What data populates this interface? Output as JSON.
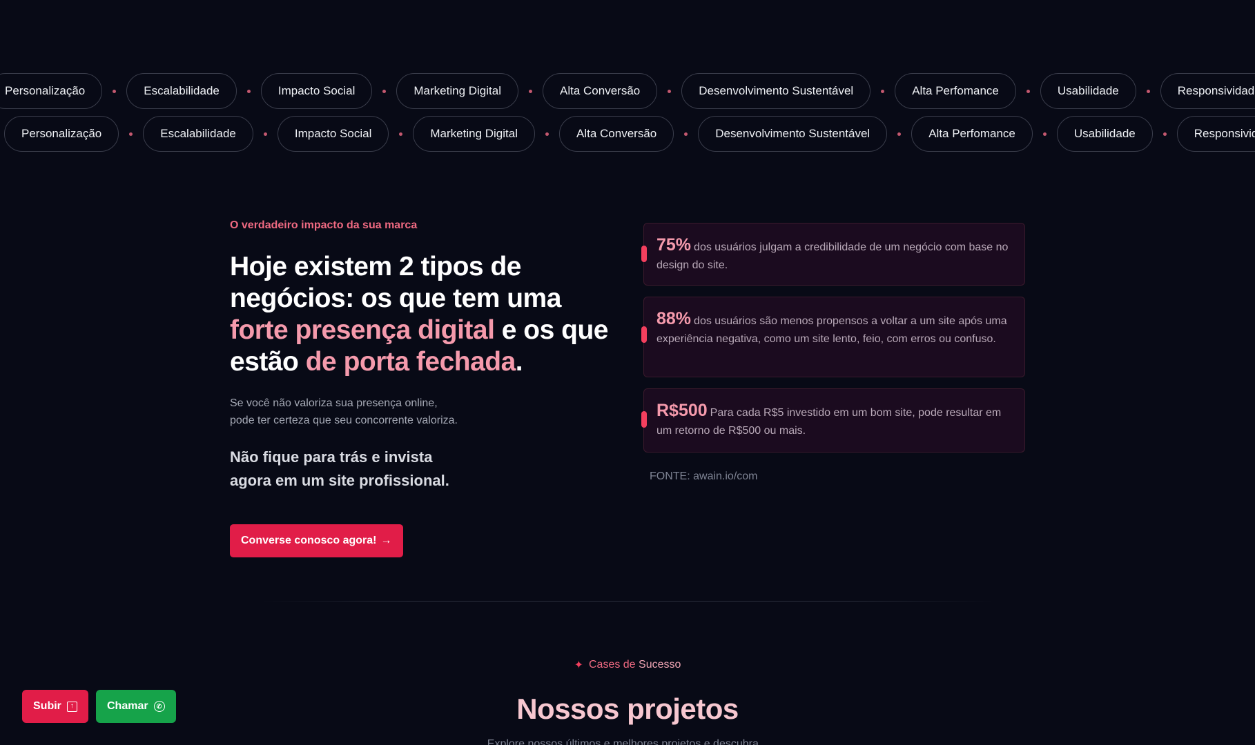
{
  "marquee": {
    "row1": [
      "Personalização",
      "Escalabilidade",
      "Impacto Social",
      "Marketing Digital",
      "Alta Conversão",
      "Desenvolvimento Sustentável",
      "Alta Perfomance",
      "Usabilidade",
      "Responsividade"
    ],
    "row2": [
      "Personalização",
      "Escalabilidade",
      "Impacto Social",
      "Marketing Digital",
      "Alta Conversão",
      "Desenvolvimento Sustentável",
      "Alta Perfomance",
      "Usabilidade",
      "Responsividade"
    ]
  },
  "hero": {
    "eyebrow": "O verdadeiro impacto da sua marca",
    "headline_part1": "Hoje existem 2 tipos de negócios: os que tem uma ",
    "headline_highlight1": "forte presença digital",
    "headline_part2": " e os que estão ",
    "headline_highlight2": "de porta fechada",
    "headline_end": ".",
    "lead_line1": "Se você não valoriza sua presença online,",
    "lead_line2": "pode ter certeza que seu concorrente valoriza.",
    "cta_line1": "Não fique para trás e invista",
    "cta_line2": "agora em um site profissional.",
    "cta_button": "Converse conosco agora!",
    "cta_arrow": "→"
  },
  "stats": [
    {
      "value": "75%",
      "text": "dos usuários julgam a credibilidade de um negócio com base no design do site."
    },
    {
      "value": "88%",
      "text": "dos usuários são menos propensos a voltar a um site após uma experiência negativa, como um site lento, feio, com erros ou confuso."
    },
    {
      "value": "R$500",
      "text": "Para cada R$5 investido em um bom site, pode resultar em um retorno de R$500 ou mais."
    }
  ],
  "source": "FONTE: awain.io/com",
  "cases": {
    "sparkle": "✦",
    "label_a": "Cases de",
    "label_b": "Sucesso",
    "title": "Nossos projetos",
    "subtitle": "Explore nossos últimos e melhores projetos e descubra..."
  },
  "floating": {
    "up_label": "Subir",
    "up_icon": "↑",
    "chat_label": "Chamar",
    "chat_icon": "✆"
  },
  "colors": {
    "background": "#080a16",
    "accent": "#e11d48",
    "accent_pink": "#f59aac",
    "whatsapp": "#16a34a"
  }
}
